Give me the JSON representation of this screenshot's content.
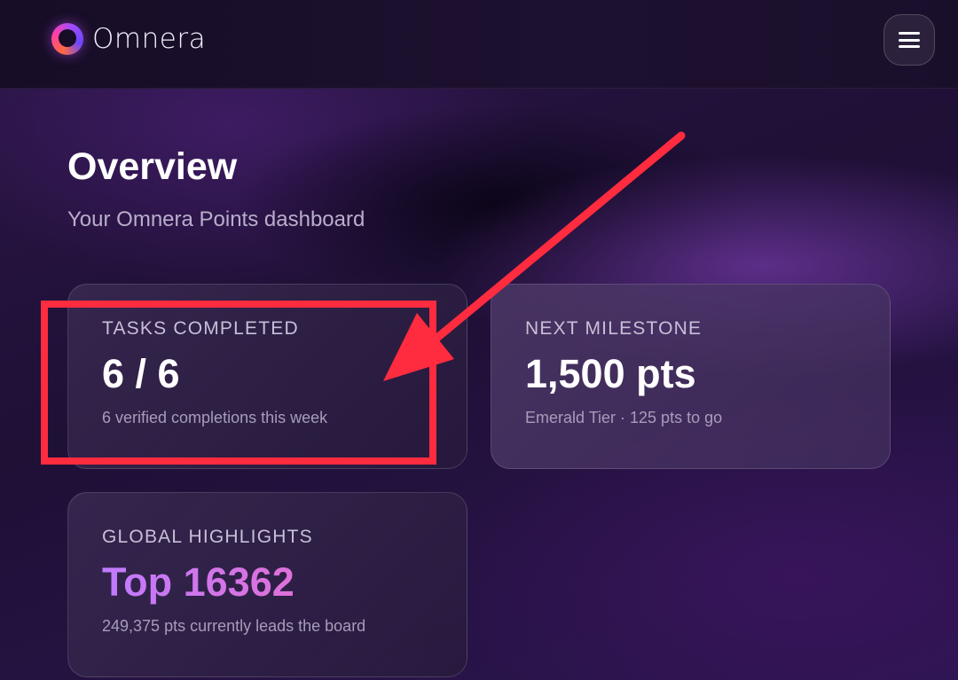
{
  "header": {
    "brand": "Omnera",
    "menu_icon": "hamburger-menu-icon"
  },
  "page": {
    "title": "Overview",
    "subtitle": "Your Omnera Points dashboard"
  },
  "cards": {
    "tasks": {
      "label": "TASKS COMPLETED",
      "value": "6 / 6",
      "note": "6 verified completions this week"
    },
    "milestone": {
      "label": "NEXT MILESTONE",
      "value": "1,500 pts",
      "note": "Emerald Tier · 125 pts to go"
    },
    "highlights": {
      "label": "GLOBAL HIGHLIGHTS",
      "value": "Top 16362",
      "note": "249,375 pts currently leads the board"
    }
  },
  "annotation": {
    "color": "#ff2b3f"
  },
  "colors": {
    "accent_gradient_start": "#c07bff",
    "accent_gradient_end": "#ff6fb0"
  }
}
